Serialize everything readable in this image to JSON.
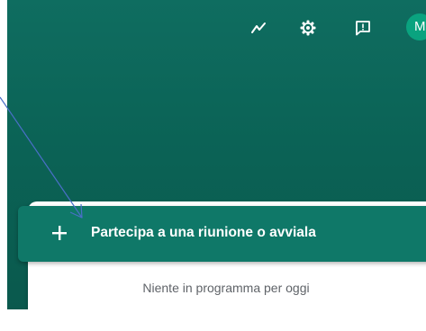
{
  "header": {
    "icons": [
      "activity-icon",
      "settings-icon",
      "feedback-icon"
    ],
    "avatar_letter": "M"
  },
  "main": {
    "join_label": "Partecipa a una riunione o avviala",
    "empty_message": "Niente in programma per oggi"
  },
  "colors": {
    "background": "#0b6356",
    "join_bar": "#0f7868",
    "avatar": "#0aa37f",
    "annotation_arrow": "#4a6fc7"
  }
}
